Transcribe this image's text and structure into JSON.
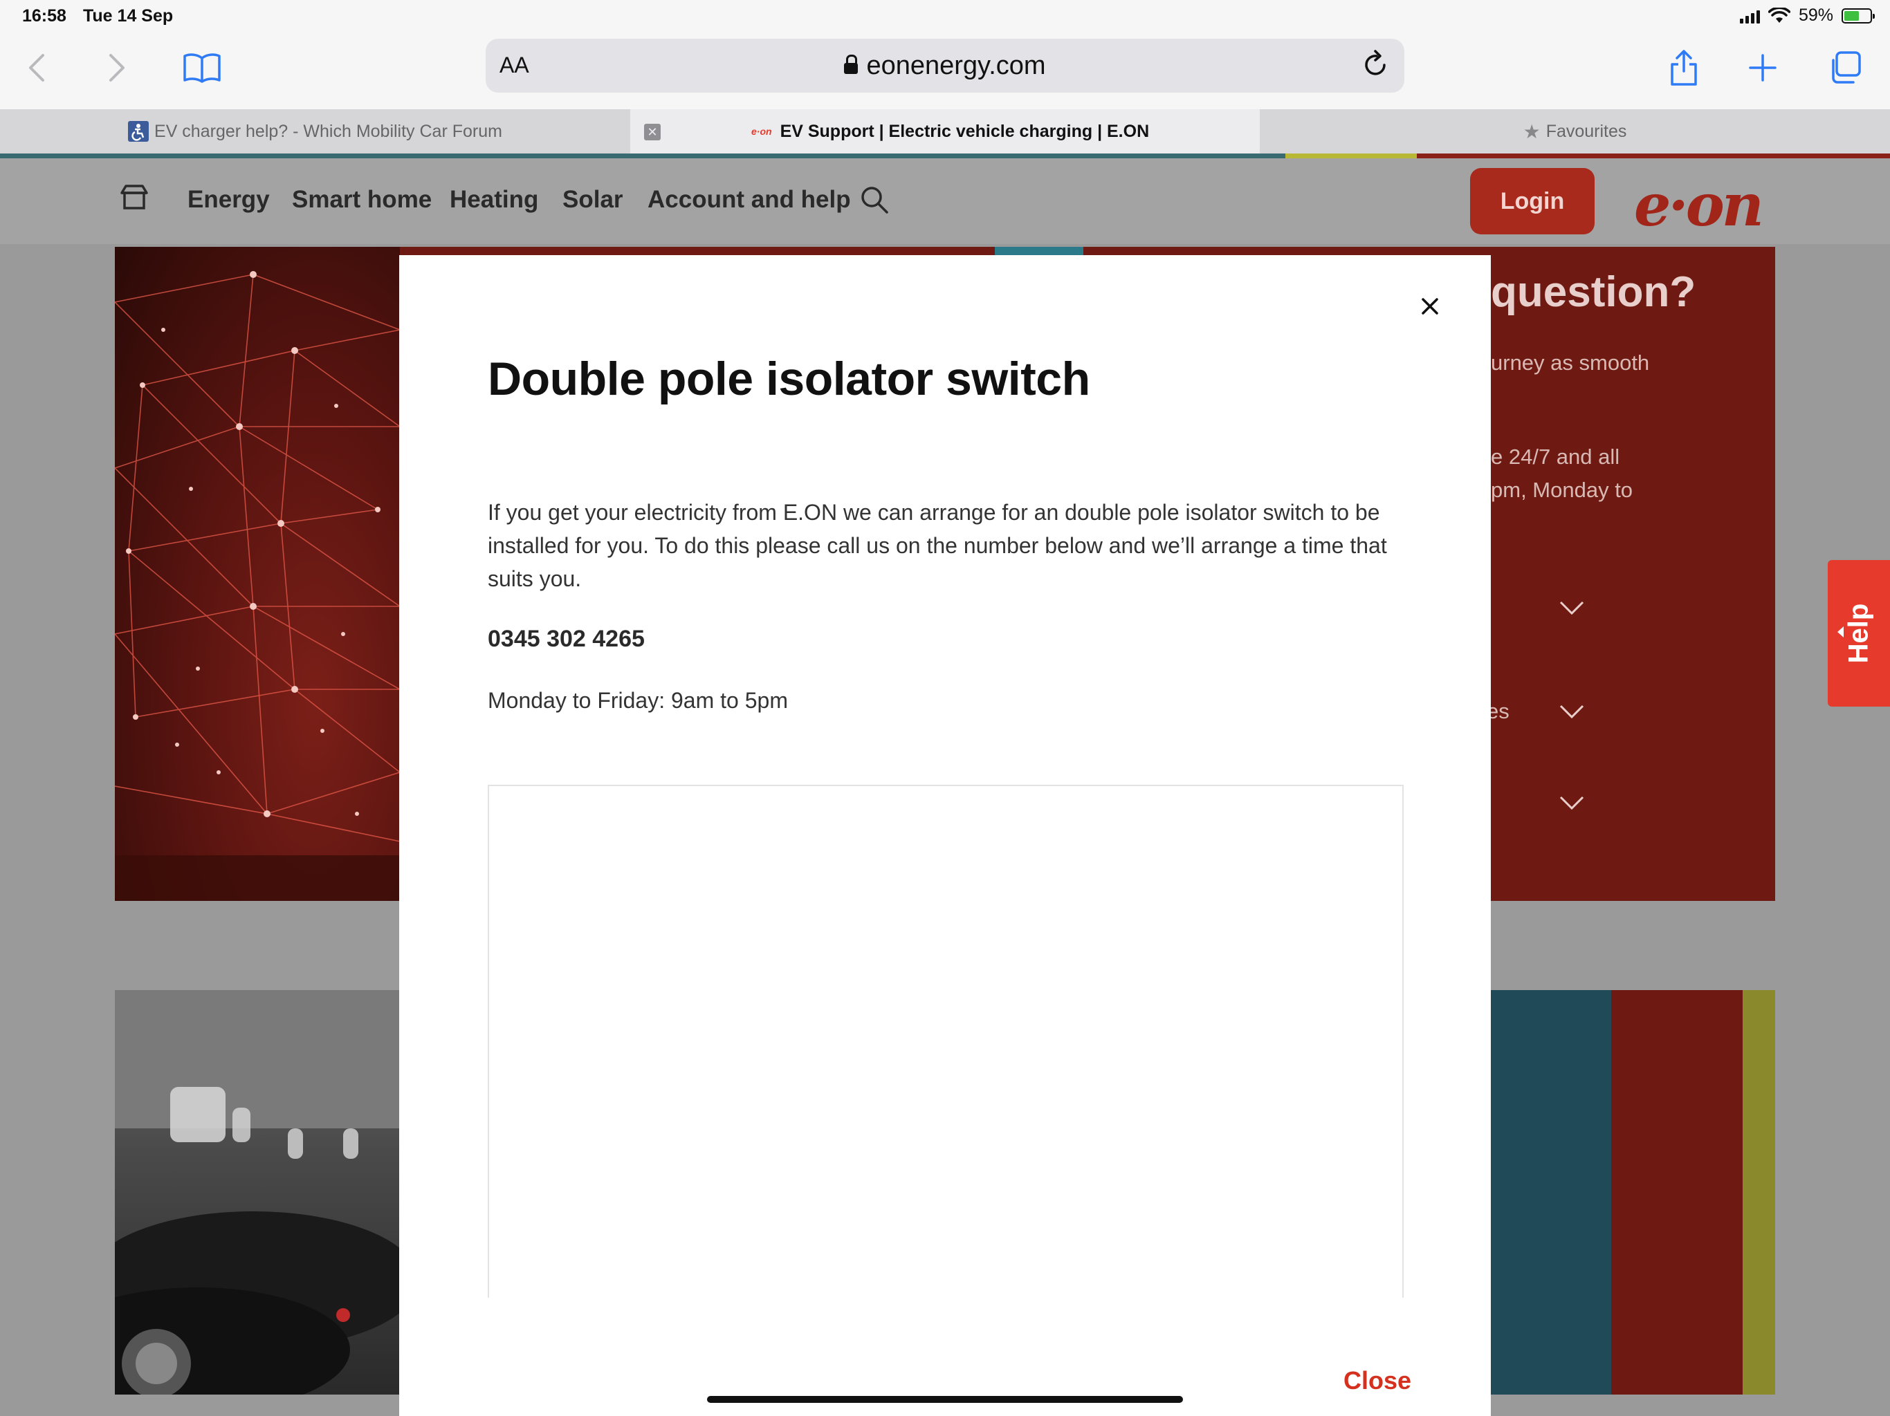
{
  "status_bar": {
    "time": "16:58",
    "date": "Tue 14 Sep",
    "battery": "59%",
    "battery_level": 0.59
  },
  "browser": {
    "reader_label": "AA",
    "url": "eonenergy.com",
    "tabs": [
      {
        "title": "EV charger help? - Which Mobility Car Forum",
        "active": false
      },
      {
        "title": "EV Support | Electric vehicle charging | E.ON",
        "active": true
      },
      {
        "title": "Favourites",
        "active": false
      }
    ],
    "icons": [
      "back-icon",
      "forward-icon",
      "bookmarks-icon",
      "reload-icon",
      "share-icon",
      "new-tab-icon",
      "tabs-overview-icon"
    ]
  },
  "site": {
    "nav": [
      "Energy",
      "Smart home",
      "Heating",
      "Solar",
      "Account and help"
    ],
    "login_label": "Login",
    "logo_text": "e·on",
    "help_label": "Help",
    "right_panel": {
      "heading": "question?",
      "line1": "urney as smooth",
      "line2": "e 24/7 and all",
      "line3": "pm, Monday to",
      "line4": "es"
    },
    "colors": {
      "brand_red": "#e63a2c",
      "dark_red": "#6e1a12",
      "teal": "#214a59",
      "olive": "#8a8a2c"
    }
  },
  "modal": {
    "title": "Double pole isolator switch",
    "body": "If you get your electricity from E.ON we can arrange for an double pole isolator switch to be installed for you. To do this please call us on the number below and we’ll arrange a time that suits you.",
    "phone": "0345 302 4265",
    "hours": "Monday to Friday: 9am to 5pm",
    "close_label": "Close"
  }
}
